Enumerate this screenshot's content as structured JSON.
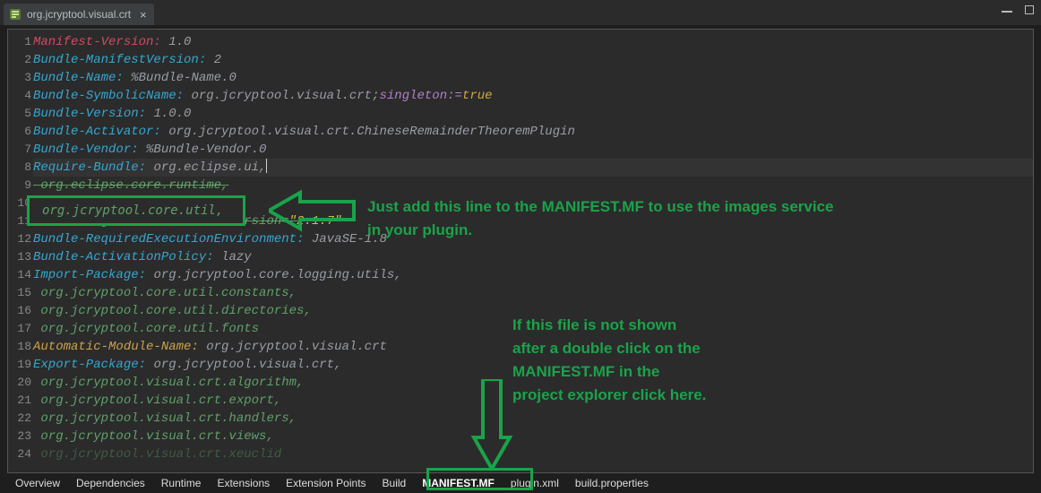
{
  "tab": {
    "title": "org.jcryptool.visual.crt"
  },
  "code": {
    "lines": [
      {
        "n": 1,
        "key": "Manifest-Version",
        "kc": "k-red",
        "val": "1.0"
      },
      {
        "n": 2,
        "key": "Bundle-ManifestVersion",
        "kc": "k-cyan",
        "val": "2"
      },
      {
        "n": 3,
        "key": "Bundle-Name",
        "kc": "k-cyan",
        "val": "%Bundle-Name.0"
      },
      {
        "n": 4,
        "key": "Bundle-SymbolicName",
        "kc": "k-cyan",
        "val": "org.jcryptool.visual.crt",
        "extra": "singleton",
        "extraVal": "true"
      },
      {
        "n": 5,
        "key": "Bundle-Version",
        "kc": "k-cyan",
        "val": "1.0.0"
      },
      {
        "n": 6,
        "key": "Bundle-Activator",
        "kc": "k-cyan",
        "val": "org.jcryptool.visual.crt.ChineseRemainderTheoremPlugin"
      },
      {
        "n": 7,
        "key": "Bundle-Vendor",
        "kc": "k-cyan",
        "val": "%Bundle-Vendor.0"
      },
      {
        "n": 8,
        "key": "Require-Bundle",
        "kc": "k-cyan",
        "val": "org.eclipse.ui,",
        "current": true
      },
      {
        "n": 9,
        "cont": " org.eclipse.core.runtime,",
        "strike": true
      },
      {
        "n": 10,
        "cont": " org.jcryptool.core.util,",
        "hidden": true
      },
      {
        "n": 11,
        "cont": " com.lowagie.itext;bundle-version=\"2.1.7\"",
        "strike": true,
        "hasStr": true
      },
      {
        "n": 12,
        "key": "Bundle-RequiredExecutionEnvironment",
        "kc": "k-cyan",
        "val": "JavaSE-1.8"
      },
      {
        "n": 13,
        "key": "Bundle-ActivationPolicy",
        "kc": "k-cyan",
        "val": "lazy"
      },
      {
        "n": 14,
        "key": "Import-Package",
        "kc": "k-cyan",
        "val": "org.jcryptool.core.logging.utils,"
      },
      {
        "n": 15,
        "cont": " org.jcryptool.core.util.constants,"
      },
      {
        "n": 16,
        "cont": " org.jcryptool.core.util.directories,"
      },
      {
        "n": 17,
        "cont": " org.jcryptool.core.util.fonts"
      },
      {
        "n": 18,
        "key": "Automatic-Module-Name",
        "kc": "k-orange",
        "val": "org.jcryptool.visual.crt"
      },
      {
        "n": 19,
        "key": "Export-Package",
        "kc": "k-cyan",
        "val": "org.jcryptool.visual.crt,"
      },
      {
        "n": 20,
        "cont": " org.jcryptool.visual.crt.algorithm,"
      },
      {
        "n": 21,
        "cont": " org.jcryptool.visual.crt.export,"
      },
      {
        "n": 22,
        "cont": " org.jcryptool.visual.crt.handlers,"
      },
      {
        "n": 23,
        "cont": " org.jcryptool.visual.crt.views,"
      },
      {
        "n": 24,
        "cont": " org.jcryptool.visual.crt.xeuclid",
        "faded": true
      }
    ]
  },
  "bottomTabs": {
    "items": [
      "Overview",
      "Dependencies",
      "Runtime",
      "Extensions",
      "Extension Points",
      "Build",
      "MANIFEST.MF",
      "plugin.xml",
      "build.properties"
    ],
    "active": "MANIFEST.MF"
  },
  "annotations": {
    "addLineBox": " org.jcryptool.core.util,",
    "text1_l1": "Just add this line to the MANIFEST.MF to use the images service",
    "text1_l2": "in your plugin.",
    "text2_l1": "If this file is not shown",
    "text2_l2": "after a double click on the",
    "text2_l3": "MANIFEST.MF in the",
    "text2_l4": "project explorer click here."
  }
}
